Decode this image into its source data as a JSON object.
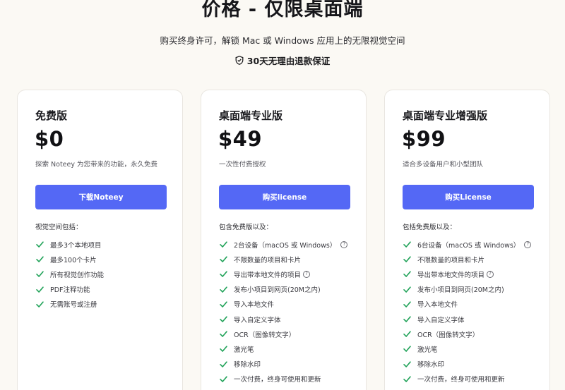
{
  "header": {
    "title": "价格 - 仅限桌面端",
    "subtitle": "购买终身许可，解锁 Mac 或 Windows 应用上的无限视觉空间",
    "guarantee": "30天无理由退款保证"
  },
  "colors": {
    "accent": "#5468f5",
    "check": "#22a35a",
    "background": "#fbf9f4"
  },
  "plans": [
    {
      "name": "免费版",
      "price": "$0",
      "description": "探索 Noteey 为您带来的功能，永久免费",
      "cta": "下载Noteey",
      "includes": "视觉空间包括：",
      "features": [
        "最多3个本地项目",
        "最多100个卡片",
        "所有视觉创作功能",
        "PDF注释功能",
        "无需账号或注册"
      ]
    },
    {
      "name": "桌面端专业版",
      "price": "$49",
      "description": "一次性付费授权",
      "cta": "购买license",
      "includes": "包含免费版以及：",
      "features": [
        "2台设备（macOS 或 Windows）",
        "不限数量的项目和卡片",
        "导出带本地文件的项目",
        "发布小项目到网页(20M之内)",
        "导入本地文件",
        "导入自定义字体",
        "OCR（图像转文字）",
        "激光笔",
        "移除水印",
        "一次付费，终身可使用和更新"
      ]
    },
    {
      "name": "桌面端专业增强版",
      "price": "$99",
      "description": "适合多设备用户和小型团队",
      "cta": "购买License",
      "includes": "包括免费版以及：",
      "features": [
        "6台设备（macOS 或 Windows）",
        "不限数量的项目和卡片",
        "导出带本地文件的项目",
        "发布小项目到网页(20M之内)",
        "导入本地文件",
        "导入自定义字体",
        "OCR（图像转文字）",
        "激光笔",
        "移除水印",
        "一次付费，终身可使用和更新"
      ]
    }
  ],
  "icons": {
    "guarantee": "shield-check-icon",
    "feature": "check-icon",
    "help": "question-circle-icon"
  }
}
